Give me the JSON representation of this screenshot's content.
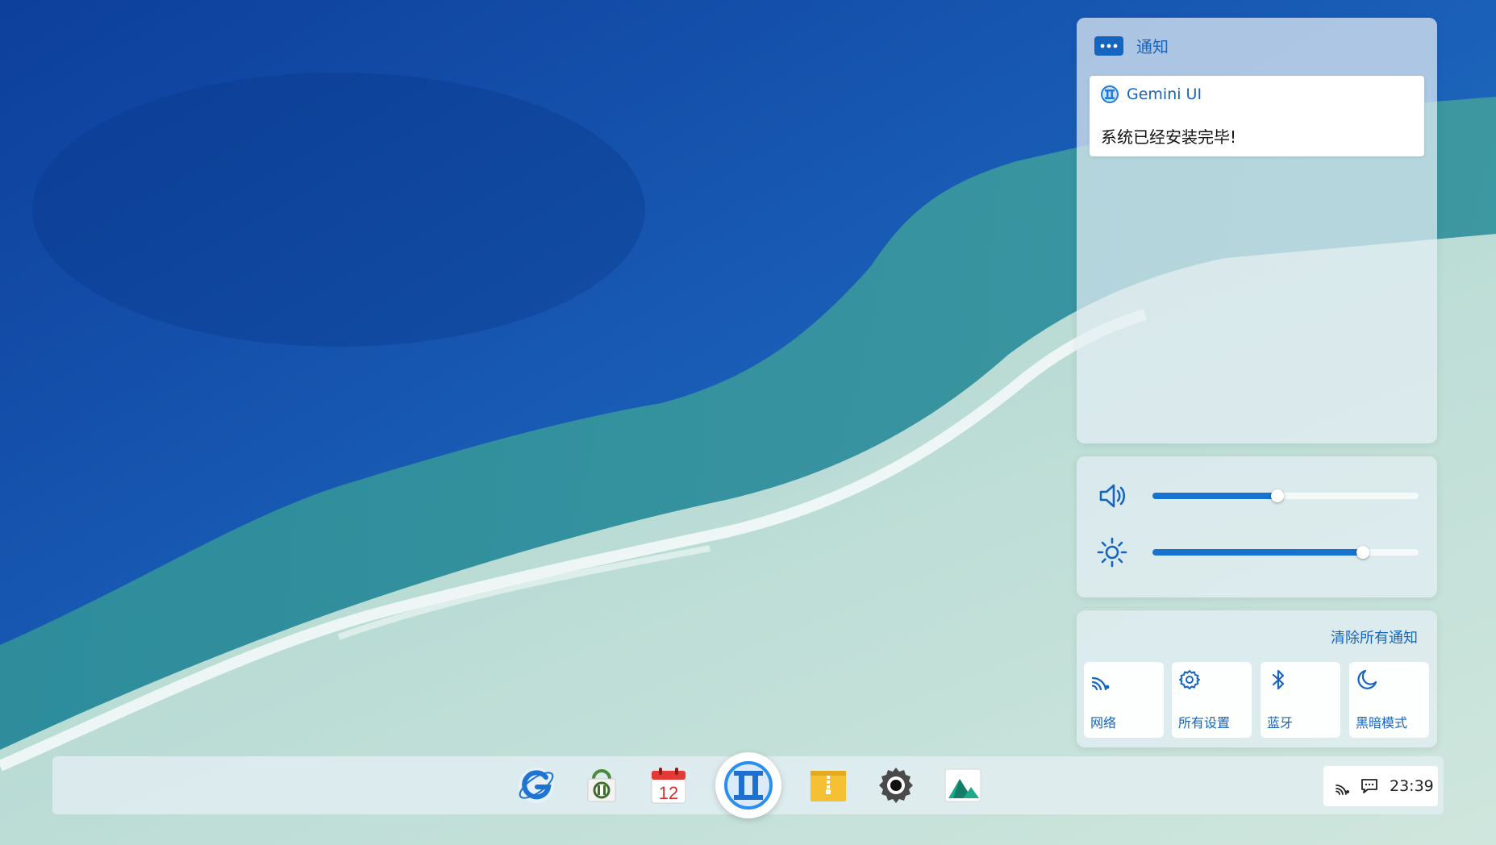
{
  "notifications": {
    "title": "通知",
    "header_icon": "message-dots-icon",
    "items": [
      {
        "app_name": "Gemini UI",
        "app_icon": "gemini-ui-icon",
        "message": "系统已经安装完毕!"
      }
    ]
  },
  "sliders": {
    "volume": {
      "icon": "speaker-icon",
      "level_percent": 47
    },
    "brightness": {
      "icon": "sun-icon",
      "level_percent": 79
    }
  },
  "quick_settings": {
    "clear_all_label": "清除所有通知",
    "tiles": [
      {
        "label": "网络",
        "icon": "wifi-icon"
      },
      {
        "label": "所有设置",
        "icon": "gear-icon"
      },
      {
        "label": "蓝牙",
        "icon": "bluetooth-icon"
      },
      {
        "label": "黑暗模式",
        "icon": "moon-icon"
      }
    ]
  },
  "taskbar": {
    "apps": [
      {
        "name": "browser-app-icon"
      },
      {
        "name": "store-app-icon"
      },
      {
        "name": "calendar-app-icon",
        "day": "12"
      },
      {
        "name": "gemini-launcher-icon"
      },
      {
        "name": "archive-app-icon"
      },
      {
        "name": "settings-app-icon"
      },
      {
        "name": "gallery-app-icon"
      }
    ],
    "tray": {
      "network_icon": "wifi-icon",
      "message_icon": "chat-icon",
      "clock": "23:39"
    }
  },
  "colors": {
    "accent": "#1565c0",
    "slider_fill": "#1673d0"
  }
}
